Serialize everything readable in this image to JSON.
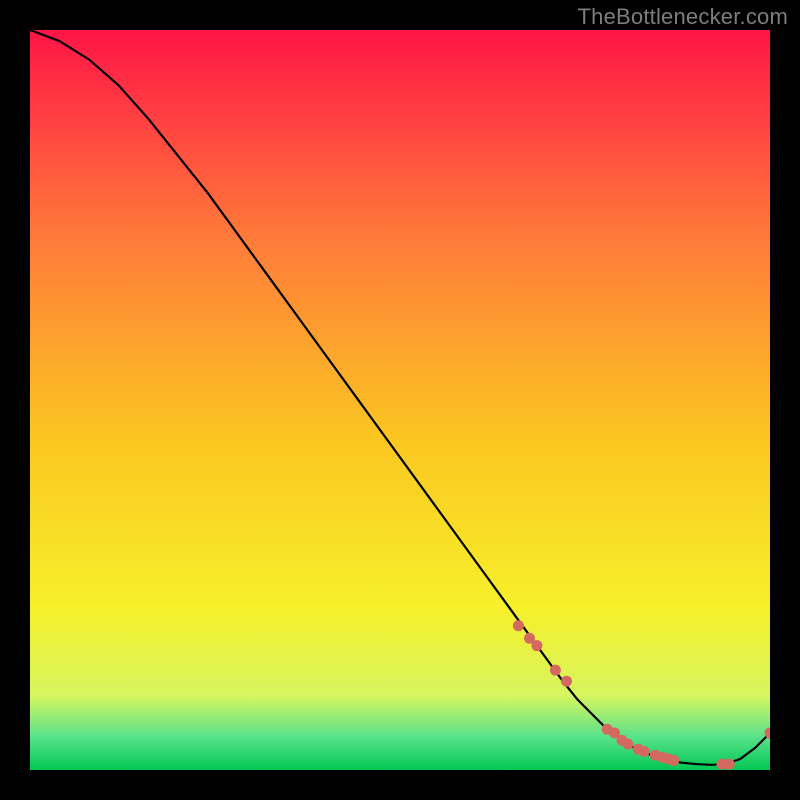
{
  "watermark": "TheBottlenecker.com",
  "colors": {
    "gradient_top": "#ff1546",
    "gradient_mid1": "#ff7a3a",
    "gradient_mid2": "#fbc621",
    "gradient_mid3": "#f7f02a",
    "gradient_low": "#d6f55f",
    "gradient_band": "#59e28a",
    "gradient_bottom": "#00c853",
    "line": "#000000",
    "marker": "#d46a5f",
    "background": "#000000"
  },
  "chart_data": {
    "type": "line",
    "title": "",
    "xlabel": "",
    "ylabel": "",
    "xlim": [
      0,
      100
    ],
    "ylim": [
      0,
      100
    ],
    "series": [
      {
        "name": "bottleneck-curve",
        "x": [
          0,
          4,
          8,
          12,
          16,
          20,
          24,
          28,
          32,
          36,
          40,
          44,
          48,
          52,
          56,
          60,
          64,
          68,
          72,
          74,
          76,
          78,
          80,
          82,
          84,
          86,
          88,
          90,
          92,
          94,
          96,
          98,
          100
        ],
        "y": [
          100,
          98.5,
          96,
          92.5,
          88,
          83,
          78,
          72.5,
          67,
          61.5,
          56,
          50.5,
          45,
          39.5,
          34,
          28.5,
          23,
          17.5,
          12,
          9.5,
          7.5,
          5.5,
          4,
          2.8,
          2,
          1.4,
          1,
          0.8,
          0.7,
          0.8,
          1.5,
          3,
          5
        ]
      }
    ],
    "markers": {
      "name": "highlighted-points",
      "x": [
        66,
        67.5,
        68.5,
        71,
        72.5,
        78,
        79,
        80,
        80.8,
        82.2,
        83,
        84.5,
        85.5,
        86.3,
        87,
        93.5,
        94.5,
        100
      ],
      "y": [
        19.5,
        17.8,
        16.8,
        13.5,
        12,
        5.5,
        5,
        4,
        3.5,
        2.8,
        2.5,
        2,
        1.7,
        1.5,
        1.3,
        0.8,
        0.8,
        5
      ]
    }
  }
}
